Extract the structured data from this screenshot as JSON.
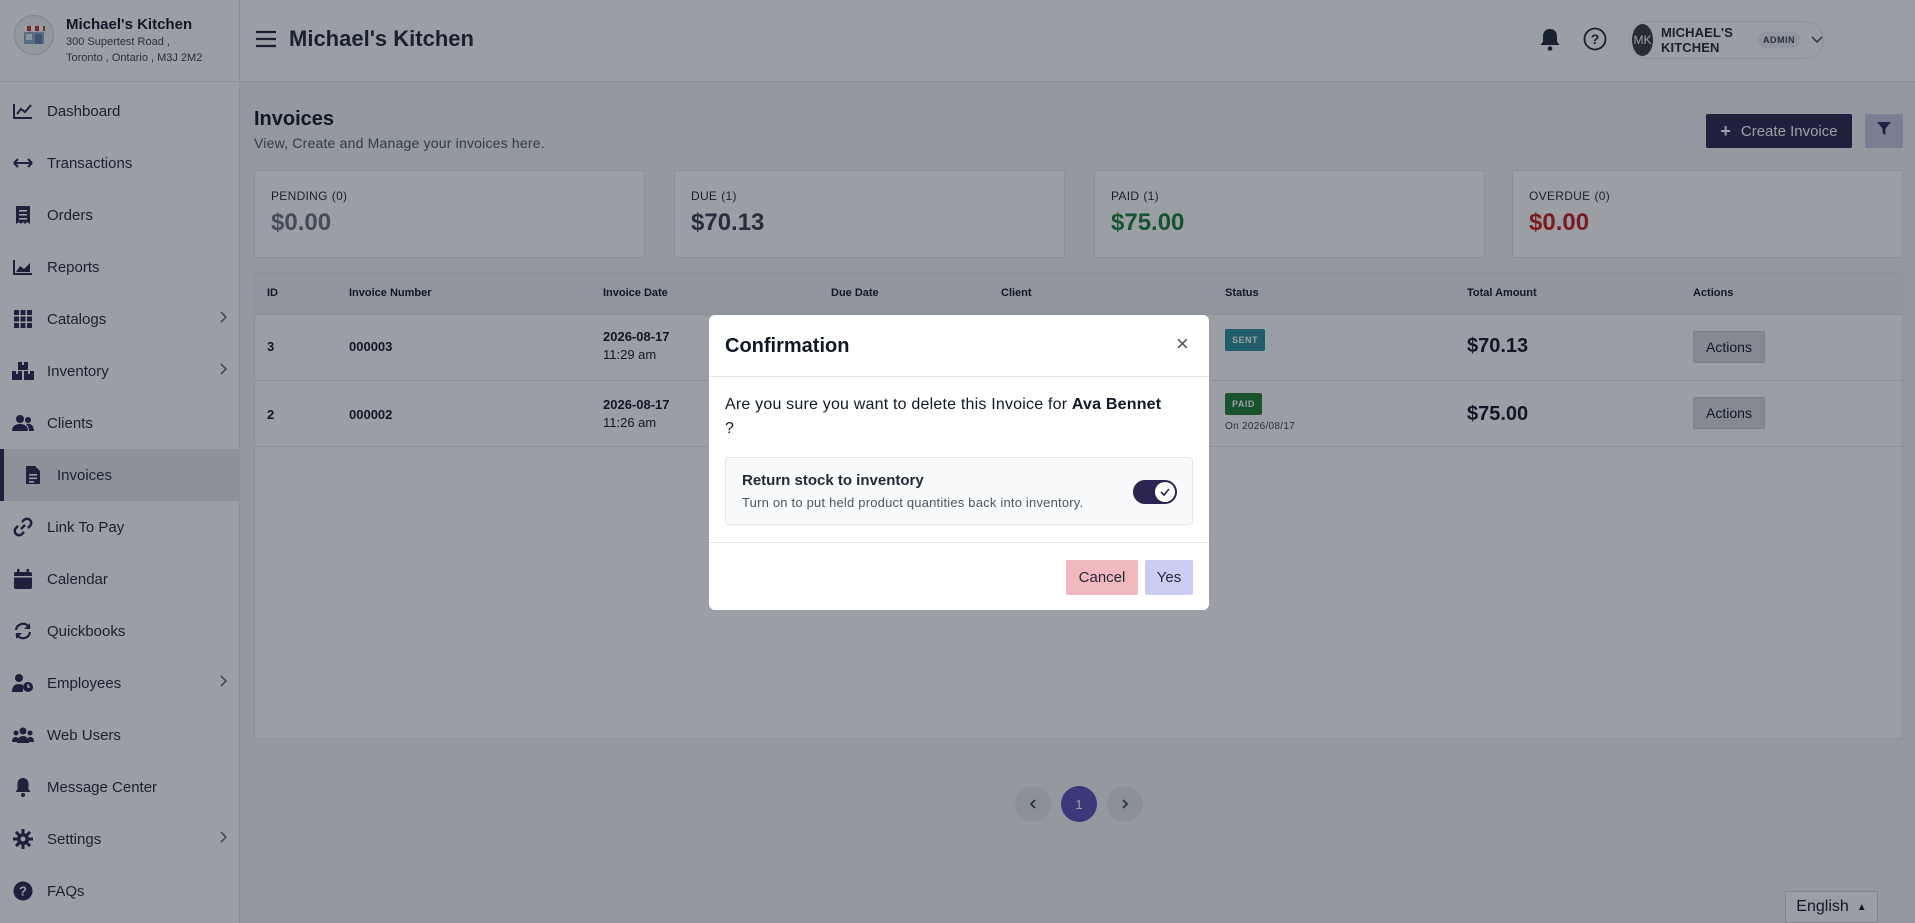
{
  "store": {
    "name": "Michael's Kitchen",
    "address_line1": "300 Supertest Road ,",
    "address_line2": "Toronto , Ontario , M3J 2M2"
  },
  "sidebar": {
    "items": [
      {
        "label": "Dashboard",
        "icon": "chart-line-icon"
      },
      {
        "label": "Transactions",
        "icon": "arrows-left-right-icon"
      },
      {
        "label": "Orders",
        "icon": "receipt-icon"
      },
      {
        "label": "Reports",
        "icon": "chart-area-icon"
      },
      {
        "label": "Catalogs",
        "icon": "grid-icon",
        "has_children": true
      },
      {
        "label": "Inventory",
        "icon": "boxes-icon",
        "has_children": true
      },
      {
        "label": "Clients",
        "icon": "users-icon"
      },
      {
        "label": "Invoices",
        "icon": "file-invoice-icon",
        "active": true
      },
      {
        "label": "Link To Pay",
        "icon": "link-icon"
      },
      {
        "label": "Calendar",
        "icon": "calendar-icon"
      },
      {
        "label": "Quickbooks",
        "icon": "sync-icon"
      },
      {
        "label": "Employees",
        "icon": "user-clock-icon",
        "has_children": true
      },
      {
        "label": "Web Users",
        "icon": "user-group-icon"
      },
      {
        "label": "Message Center",
        "icon": "bell-icon"
      },
      {
        "label": "Settings",
        "icon": "gear-icon",
        "has_children": true
      },
      {
        "label": "FAQs",
        "icon": "question-circle-icon"
      }
    ]
  },
  "header": {
    "title": "Michael's Kitchen",
    "user_initials": "MK",
    "user_name": "MICHAEL'S KITCHEN",
    "user_role": "ADMIN"
  },
  "page": {
    "title": "Invoices",
    "subtitle": "View, Create and Manage your invoices here.",
    "create_label": "Create Invoice"
  },
  "summary": [
    {
      "label": "PENDING",
      "count": "(0)",
      "value": "$0.00",
      "color": "#6b7280"
    },
    {
      "label": "DUE",
      "count": "(1)",
      "value": "$70.13",
      "color": "#374151"
    },
    {
      "label": "PAID",
      "count": "(1)",
      "value": "$75.00",
      "color": "#16803c"
    },
    {
      "label": "OVERDUE",
      "count": "(0)",
      "value": "$0.00",
      "color": "#c81e1e"
    }
  ],
  "table": {
    "columns": [
      "ID",
      "Invoice Number",
      "Invoice Date",
      "Due Date",
      "Client",
      "Status",
      "Total Amount",
      "Actions"
    ],
    "rows": [
      {
        "id": "3",
        "number": "000003",
        "date": "2026-08-17",
        "time": "11:29 am",
        "status": "SENT",
        "status_color": "#2f8f9d",
        "status_note": "",
        "total": "$70.13",
        "action": "Actions"
      },
      {
        "id": "2",
        "number": "000002",
        "date": "2026-08-17",
        "time": "11:26 am",
        "status": "PAID",
        "status_color": "#1e7e34",
        "status_note": "On 2026/08/17",
        "total": "$75.00",
        "action": "Actions"
      }
    ]
  },
  "pagination": {
    "current": "1"
  },
  "language": "English",
  "modal": {
    "title": "Confirmation",
    "text_before": "Are you sure you want to delete this Invoice for ",
    "client_name": "Ava Bennet",
    "text_after": "?",
    "toggle_title": "Return stock to inventory",
    "toggle_desc": "Turn on to put held product quantities back into inventory.",
    "toggle_on": true,
    "cancel_label": "Cancel",
    "yes_label": "Yes"
  },
  "colors": {
    "brand": "#2a2550",
    "accent": "#5b50b8"
  }
}
